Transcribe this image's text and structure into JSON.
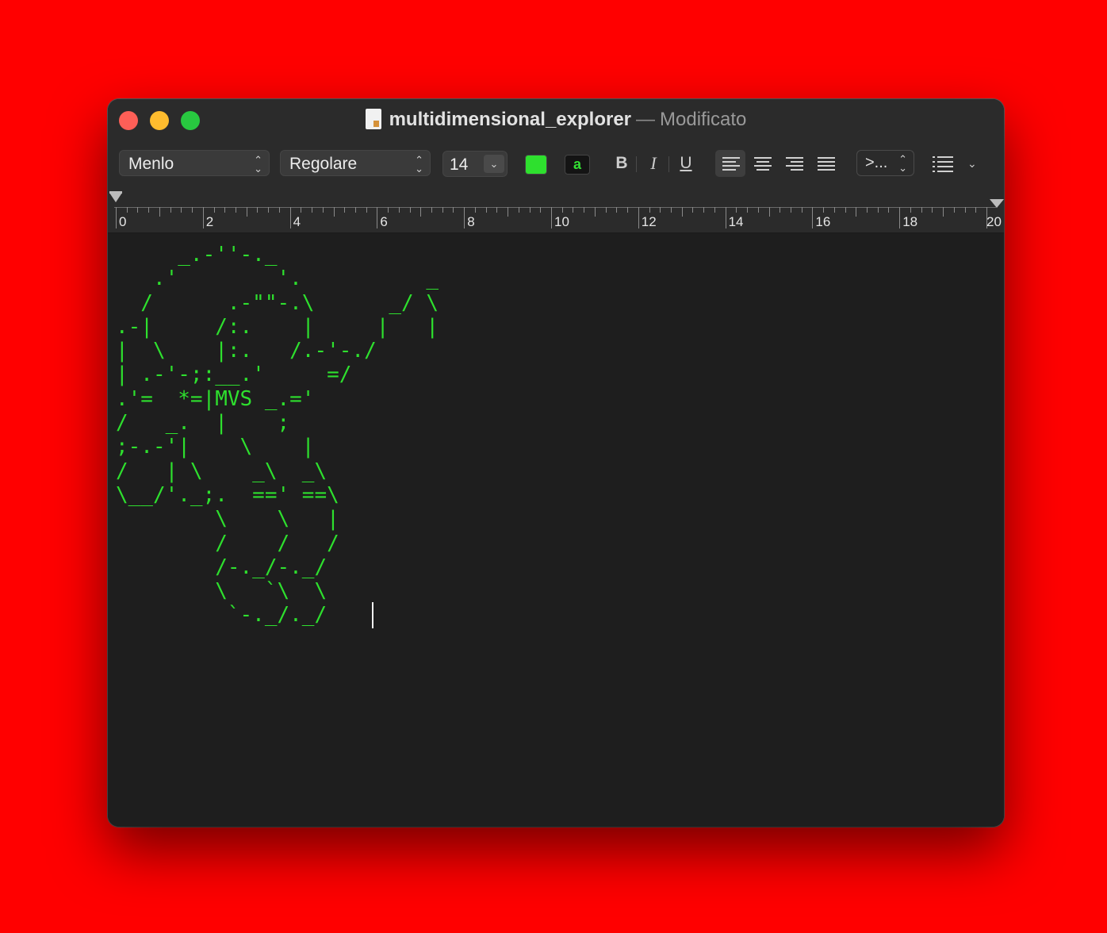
{
  "window": {
    "title": "multidimensional_explorer",
    "separator": "—",
    "status": "Modificato"
  },
  "toolbar": {
    "font_family": "Menlo",
    "font_style": "Regolare",
    "font_size": "14",
    "text_color": "#2ee02e",
    "background_color_label": "a",
    "bold_label": "B",
    "italic_label": "I",
    "underline_label": "U",
    "alignment_selected": "left",
    "spacing_label": ">...",
    "list_icon": "list-bullets-icon"
  },
  "ruler": {
    "labels": [
      "0",
      "2",
      "4",
      "6",
      "8",
      "10",
      "12",
      "14",
      "16",
      "18",
      "20"
    ]
  },
  "document": {
    "ascii_lines": [
      "     _.-''-._",
      "   .'        '.          _",
      "  /      .-\"\"-.\\      _/ \\",
      ".-|     /:.    |     |   |",
      "|  \\    |:.   /.-'-./",
      "| .-'-;:__.'     =/",
      ".'=  *=|MVS _.='",
      "/   _.  |    ;",
      ";-.-'|    \\    |",
      "/   | \\    _\\  _\\",
      "\\__/'._;.  ==' ==\\",
      "        \\    \\   |",
      "        /    /   /",
      "        /-._/-._/",
      "        \\   `\\  \\",
      "         `-._/._/"
    ]
  },
  "colors": {
    "desktop": "#ff0000",
    "editor_bg": "#1e1e1e",
    "text": "#2ee02e"
  }
}
